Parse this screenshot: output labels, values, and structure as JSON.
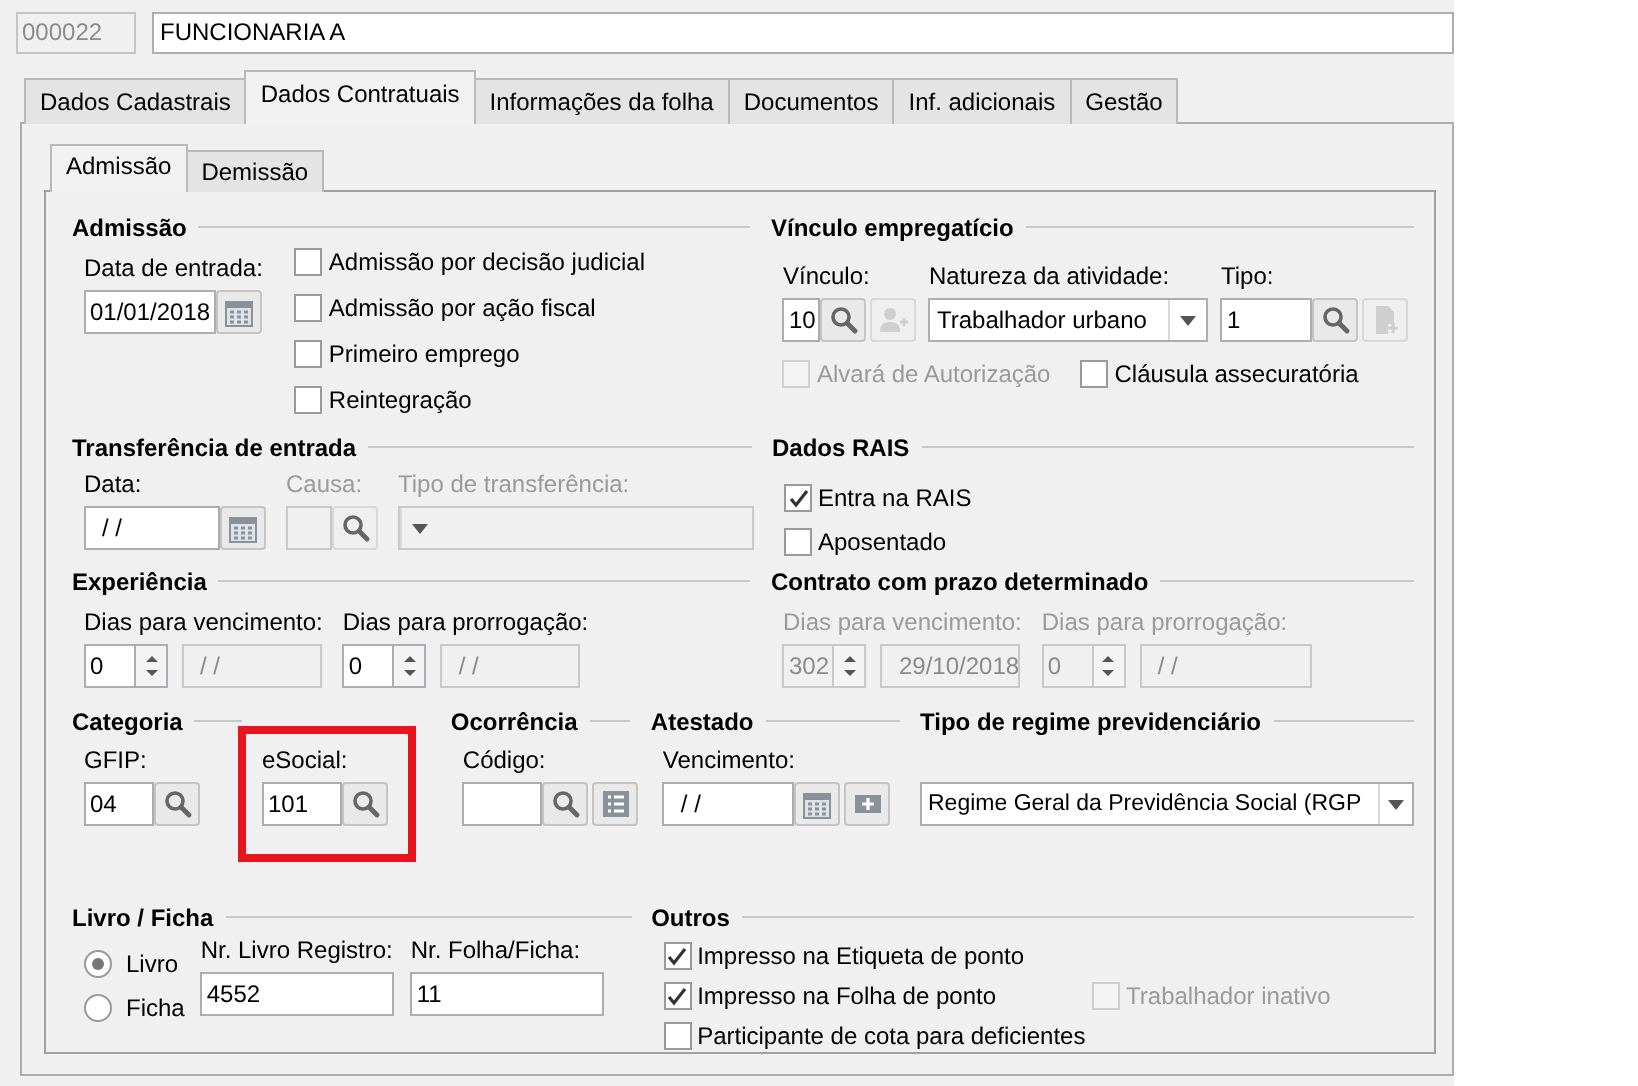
{
  "record": {
    "code": "000022",
    "name": "FUNCIONARIA A"
  },
  "tabs": [
    {
      "label": "Dados Cadastrais",
      "selected": false
    },
    {
      "label": "Dados Contratuais",
      "selected": true
    },
    {
      "label": "Informações da folha",
      "selected": false
    },
    {
      "label": "Documentos",
      "selected": false
    },
    {
      "label": "Inf. adicionais",
      "selected": false
    },
    {
      "label": "Gestão",
      "selected": false
    }
  ],
  "subtabs": [
    {
      "label": "Admissão",
      "selected": true
    },
    {
      "label": "Demissão",
      "selected": false
    }
  ],
  "bands": [
    [
      {
        "title": "Admissão",
        "rows": [
          [
            {
              "kind": "date",
              "label": "Data de entrada:",
              "value": "01/01/2018",
              "disabled": false
            },
            {
              "kind": "stack",
              "children": [
                {
                  "kind": "checkbox",
                  "label": "Admissão por decisão judicial",
                  "checked": false,
                  "disabled": false
                },
                {
                  "kind": "checkbox",
                  "label": "Admissão por ação fiscal",
                  "checked": false,
                  "disabled": false
                },
                {
                  "kind": "checkbox",
                  "label": "Primeiro emprego",
                  "checked": false,
                  "disabled": false
                },
                {
                  "kind": "checkbox",
                  "label": "Reintegração",
                  "checked": false,
                  "disabled": false
                }
              ]
            }
          ]
        ]
      },
      {
        "title": "Vínculo empregatício",
        "rows": [
          [
            {
              "kind": "lookup",
              "label": "Vínculo:",
              "value": "10",
              "disabled": false,
              "highlighted": false,
              "extra": {
                "kind": "person-add",
                "disabled": true
              }
            },
            {
              "kind": "select",
              "label": "Natureza da atividade:",
              "value": "Trabalhador urbano",
              "disabled": false
            },
            {
              "kind": "lookup",
              "label": "Tipo:",
              "value": "1",
              "disabled": false,
              "highlighted": false,
              "extra": {
                "kind": "file-add",
                "disabled": true
              }
            }
          ],
          [
            {
              "kind": "checkbox",
              "label": "Alvará de Autorização",
              "checked": false,
              "disabled": true
            },
            {
              "kind": "checkbox",
              "label": "Cláusula assecuratória",
              "checked": false,
              "disabled": false
            }
          ]
        ]
      }
    ],
    [
      {
        "title": "Transferência de entrada",
        "rows": [
          [
            {
              "kind": "date",
              "label": "Data:",
              "value": "/ /",
              "disabled": false
            },
            {
              "kind": "lookup",
              "label": "Causa:",
              "disabled": true,
              "highlighted": false
            },
            {
              "kind": "select",
              "label": "Tipo de transferência:",
              "disabled": true
            }
          ]
        ]
      },
      {
        "title": "Dados RAIS",
        "rows": [
          [
            {
              "kind": "checkbox",
              "label": "Entra na RAIS",
              "checked": true,
              "disabled": false
            }
          ],
          [
            {
              "kind": "checkbox",
              "label": "Aposentado",
              "checked": false,
              "disabled": false
            }
          ]
        ]
      }
    ],
    [
      {
        "title": "Experiência",
        "rows": [
          [
            {
              "kind": "spinner",
              "label": "Dias para vencimento:",
              "value": "0",
              "date": "/ /",
              "disabled": false
            },
            {
              "kind": "spinner",
              "label": "Dias para prorrogação:",
              "value": "0",
              "date": "/ /",
              "disabled": false
            }
          ]
        ]
      },
      {
        "title": "Contrato com prazo determinado",
        "rows": [
          [
            {
              "kind": "spinner",
              "label": "Dias para vencimento:",
              "value": "302",
              "date": "29/10/2018",
              "disabled": true
            },
            {
              "kind": "spinner",
              "label": "Dias para prorrogação:",
              "value": "0",
              "date": "/ /",
              "disabled": true
            }
          ]
        ]
      }
    ],
    [
      {
        "title": "Categoria",
        "rows": [
          [
            {
              "kind": "lookup",
              "label": "GFIP:",
              "value": "04",
              "disabled": false,
              "highlighted": false
            },
            {
              "kind": "lookup",
              "label": "eSocial:",
              "value": "101",
              "disabled": false,
              "highlighted": true
            }
          ]
        ]
      },
      {
        "title": "Ocorrência",
        "rows": [
          [
            {
              "kind": "lookup",
              "label": "Código:",
              "disabled": false,
              "highlighted": false,
              "extra": {
                "kind": "list",
                "disabled": false
              }
            }
          ]
        ]
      },
      {
        "title": "Atestado",
        "rows": [
          [
            {
              "kind": "date",
              "label": "Vencimento:",
              "value": "/ /",
              "disabled": false,
              "extra": {
                "kind": "plus",
                "disabled": false
              }
            }
          ]
        ]
      },
      {
        "title": "Tipo de regime previdenciário",
        "rows": [
          [
            {
              "kind": "select",
              "value": "Regime Geral da Previdência Social (RGP",
              "disabled": false
            }
          ]
        ]
      }
    ],
    [
      {
        "title": "Livro / Ficha",
        "rows": [
          [
            {
              "kind": "stack",
              "children": [
                {
                  "kind": "radio",
                  "label": "Livro",
                  "selected": true
                },
                {
                  "kind": "radio",
                  "label": "Ficha",
                  "selected": false
                }
              ]
            },
            {
              "kind": "text",
              "label": "Nr. Livro Registro:",
              "value": "4552"
            },
            {
              "kind": "text",
              "label": "Nr. Folha/Ficha:",
              "value": "11"
            }
          ]
        ]
      },
      {
        "title": "Outros",
        "rows": [
          [
            {
              "kind": "checkbox",
              "label": "Impresso na Etiqueta de ponto",
              "checked": true,
              "disabled": false
            }
          ],
          [
            {
              "kind": "checkbox",
              "label": "Impresso na Folha de ponto",
              "checked": true,
              "disabled": false
            },
            {
              "kind": "checkbox",
              "label": "Trabalhador inativo",
              "checked": false,
              "disabled": true
            }
          ],
          [
            {
              "kind": "checkbox",
              "label": "Participante de cota para deficientes",
              "checked": false,
              "disabled": false
            }
          ]
        ]
      }
    ]
  ]
}
